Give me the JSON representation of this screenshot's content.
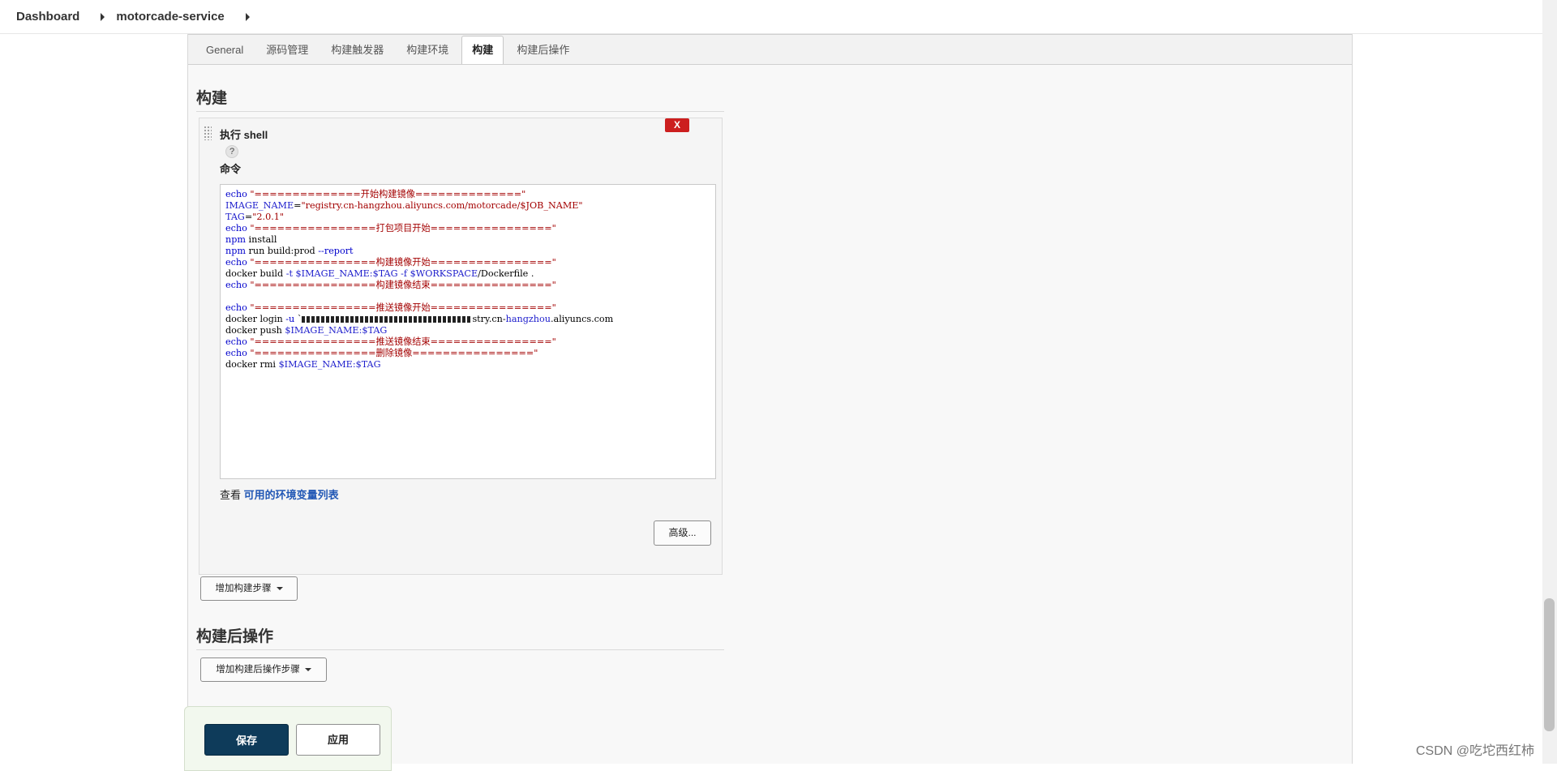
{
  "breadcrumb": {
    "items": [
      "Dashboard",
      "motorcade-service"
    ]
  },
  "tabs": [
    {
      "label": "General"
    },
    {
      "label": "源码管理"
    },
    {
      "label": "构建触发器"
    },
    {
      "label": "构建环境"
    },
    {
      "label": "构建",
      "active": true
    },
    {
      "label": "构建后操作"
    }
  ],
  "build_section": {
    "title": "构建",
    "step": {
      "title": "执行 shell",
      "delete_label": "X",
      "help_label": "?",
      "command_label": "命令",
      "command_lines": [
        [
          {
            "t": "echo ",
            "c": "kw"
          },
          {
            "t": "\"==============开始构建镜像==============\"",
            "c": "str"
          }
        ],
        [
          {
            "t": "IMAGE_NAME",
            "c": "var"
          },
          {
            "t": "=",
            "c": ""
          },
          {
            "t": "\"registry.cn-hangzhou.aliyuncs.com/motorcade/$JOB_NAME\"",
            "c": "str"
          }
        ],
        [
          {
            "t": "TAG",
            "c": "var"
          },
          {
            "t": "=",
            "c": ""
          },
          {
            "t": "\"2.0.1\"",
            "c": "str"
          }
        ],
        [
          {
            "t": "echo ",
            "c": "kw"
          },
          {
            "t": "\"================打包项目开始================\"",
            "c": "str"
          }
        ],
        [
          {
            "t": "npm ",
            "c": "kw"
          },
          {
            "t": "install",
            "c": ""
          }
        ],
        [
          {
            "t": "npm ",
            "c": "kw"
          },
          {
            "t": "run build:prod ",
            "c": ""
          },
          {
            "t": "--report",
            "c": "kw"
          }
        ],
        [
          {
            "t": "echo ",
            "c": "kw"
          },
          {
            "t": "\"================构建镜像开始================\"",
            "c": "str"
          }
        ],
        [
          {
            "t": "docker build ",
            "c": ""
          },
          {
            "t": "-t $IMAGE_NAME:$TAG -f $WORKSPACE",
            "c": "var"
          },
          {
            "t": "/Dockerfile .",
            "c": ""
          }
        ],
        [
          {
            "t": "echo ",
            "c": "kw"
          },
          {
            "t": "\"================构建镜像结束================\"",
            "c": "str"
          }
        ],
        [],
        [
          {
            "t": "echo ",
            "c": "kw"
          },
          {
            "t": "\"================推送镜像开始================\"",
            "c": "str"
          }
        ],
        [
          {
            "t": "docker login ",
            "c": ""
          },
          {
            "t": "-u",
            "c": "kw"
          },
          {
            "t": " `",
            "c": ""
          },
          {
            "t": "REDACT",
            "c": "redact"
          },
          {
            "t": "stry.cn-",
            "c": ""
          },
          {
            "t": "hangzhou",
            "c": "var"
          },
          {
            "t": ".aliyuncs.com",
            "c": ""
          }
        ],
        [
          {
            "t": "docker push ",
            "c": ""
          },
          {
            "t": "$IMAGE_NAME:$TAG",
            "c": "var"
          }
        ],
        [
          {
            "t": "echo ",
            "c": "kw"
          },
          {
            "t": "\"================推送镜像结束================\"",
            "c": "str"
          }
        ],
        [
          {
            "t": "echo ",
            "c": "kw"
          },
          {
            "t": "\"================删除镜像================\"",
            "c": "str"
          }
        ],
        [
          {
            "t": "docker rmi ",
            "c": ""
          },
          {
            "t": "$IMAGE_NAME:$TAG",
            "c": "var"
          }
        ]
      ],
      "env_prefix": "查看 ",
      "env_link": "可用的环境变量列表",
      "advanced_label": "高级..."
    },
    "add_step_label": "增加构建步骤"
  },
  "post_build_section": {
    "title": "构建后操作",
    "add_step_label": "增加构建后操作步骤"
  },
  "save_bar": {
    "save_label": "保存",
    "apply_label": "应用"
  },
  "watermark": "CSDN @吃坨西红柿",
  "colors": {
    "save_button": "#0e3b5a",
    "delete_button": "#cc1f1f",
    "link": "#2157b5"
  }
}
